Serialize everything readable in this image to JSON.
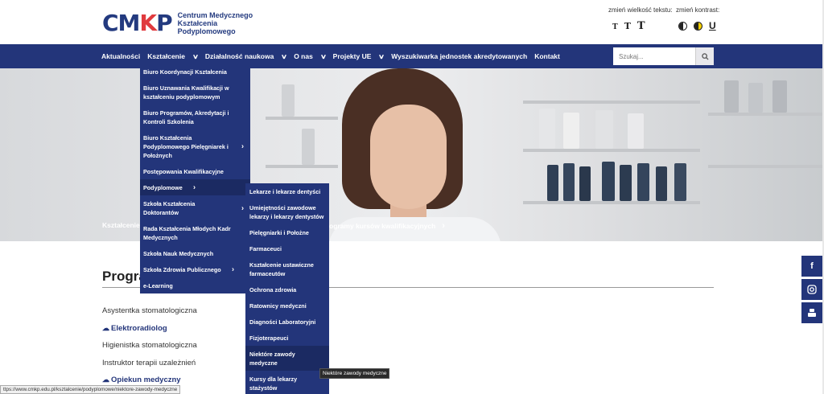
{
  "header": {
    "logo_mark_a": "CM",
    "logo_mark_k": "K",
    "logo_mark_b": "P",
    "logo_line1": "Centrum Medycznego",
    "logo_line2": "Kształcenia",
    "logo_line3": "Podyplomowego",
    "text_size_label": "zmień wielkość tekstu:",
    "text_size_small": "T",
    "text_size_medium": "T",
    "text_size_large": "T",
    "contrast_label": "zmień kontrast:",
    "contrast_underline": "U"
  },
  "nav": {
    "items": [
      {
        "label": "Aktualności"
      },
      {
        "label": "Kształcenie"
      },
      {
        "label": "Działalność naukowa"
      },
      {
        "label": "O nas"
      },
      {
        "label": "Projekty UE"
      },
      {
        "label": "Wyszukiwarka jednostek akredytowanych"
      },
      {
        "label": "Kontakt"
      }
    ],
    "chevron": "∨",
    "search_placeholder": "Szukaj..."
  },
  "hero": {
    "breadcrumb_left": "Kształcenie",
    "breadcrumb_right": "ogramy kursów kwalifikacyjnych",
    "breadcrumb_arrow": "›"
  },
  "dropdown_level1": [
    {
      "label": "Biuro Koordynacji Kształcenia"
    },
    {
      "label": "Biuro Uznawania Kwalifikacji w kształceniu podyplomowym"
    },
    {
      "label": "Biuro Programów, Akredytacji i Kontroli Szkolenia"
    },
    {
      "label": "Biuro Kształcenia Podyplomowego Pielęgniarek i Położnych"
    },
    {
      "label": "Postępowania Kwalifikacyjne"
    },
    {
      "label": "Podyplomowe"
    },
    {
      "label": "Szkoła Kształcenia Doktorantów"
    },
    {
      "label": "Rada Kształcenia Młodych Kadr Medycznych"
    },
    {
      "label": "Szkoła Nauk Medycznych"
    },
    {
      "label": "Szkoła Zdrowia Publicznego"
    },
    {
      "label": "e-Learning"
    }
  ],
  "dropdown_level2": [
    {
      "label": "Lekarze i lekarze dentyści"
    },
    {
      "label": "Umiejętności zawodowe lekarzy i lekarzy dentystów"
    },
    {
      "label": "Pielęgniarki i Położne"
    },
    {
      "label": "Farmaceuci"
    },
    {
      "label": "Kształcenie ustawiczne farmaceutów"
    },
    {
      "label": "Ochrona zdrowia"
    },
    {
      "label": "Ratownicy medyczni"
    },
    {
      "label": "Diagności Laboratoryjni"
    },
    {
      "label": "Fizjoterapeuci"
    },
    {
      "label": "Niektóre zawody medyczne"
    },
    {
      "label": "Kursy dla lekarzy stażystów"
    }
  ],
  "content": {
    "title": "Progra",
    "list": [
      {
        "label": "Asystentka stomatologiczna",
        "link": false
      },
      {
        "label": "Elektroradiolog",
        "link": true
      },
      {
        "label": "Higienistka stomatologiczna",
        "link": false
      },
      {
        "label": "Instruktor terapii uzależnień",
        "link": false
      },
      {
        "label": "Opiekun medyczny",
        "link": true
      }
    ]
  },
  "tooltip": "Niektóre zawody medyczne",
  "status_url": "ttps://www.cmkp.edu.pl/ksztalcenie/podyplomowe/niektore-zawody-medyczne",
  "social": {
    "facebook": "f",
    "instagram": "◙",
    "youtube": "▶"
  },
  "colors": {
    "brand_blue": "#23357a",
    "brand_red": "#e03a3e"
  }
}
